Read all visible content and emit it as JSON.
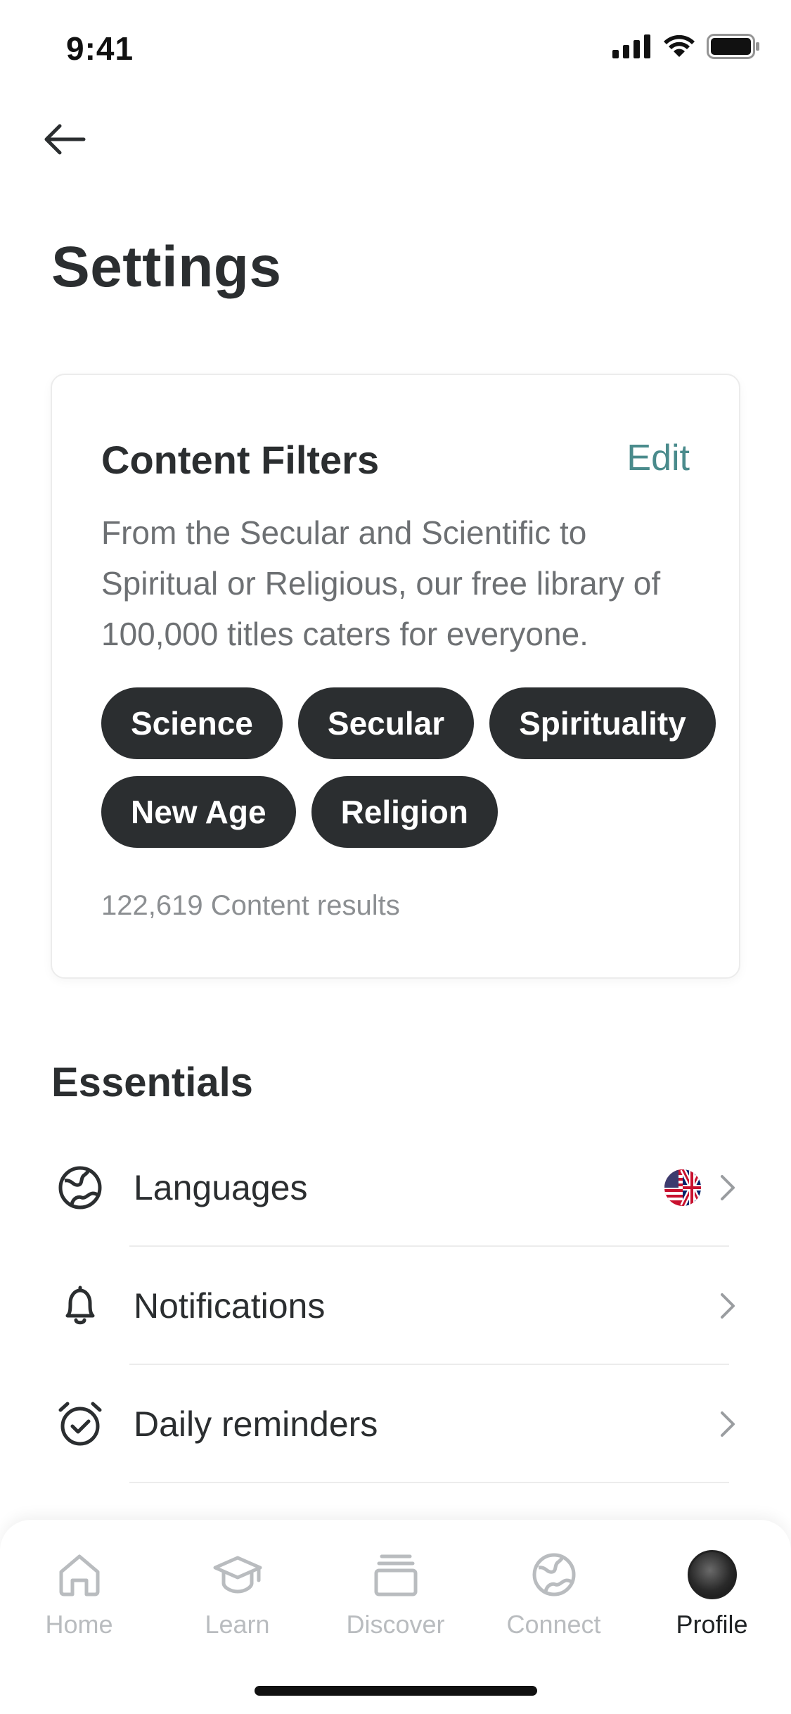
{
  "status_bar": {
    "time": "9:41"
  },
  "header": {
    "title": "Settings"
  },
  "content_filters": {
    "title": "Content Filters",
    "edit_label": "Edit",
    "description": "From the Secular and Scientific to Spiritual or Religious, our free library of 100,000 titles caters for everyone.",
    "chips": [
      "Science",
      "Secular",
      "Spirituality",
      "New Age",
      "Religion"
    ],
    "results": "122,619 Content results"
  },
  "essentials": {
    "title": "Essentials",
    "items": [
      {
        "label": "Languages",
        "icon": "globe-icon",
        "flag": "us-uk-flag"
      },
      {
        "label": "Notifications",
        "icon": "bell-icon"
      },
      {
        "label": "Daily reminders",
        "icon": "alarm-clock-icon"
      }
    ]
  },
  "tab_bar": {
    "tabs": [
      {
        "label": "Home",
        "icon": "home-icon"
      },
      {
        "label": "Learn",
        "icon": "graduation-cap-icon"
      },
      {
        "label": "Discover",
        "icon": "stack-icon"
      },
      {
        "label": "Connect",
        "icon": "globe-icon"
      },
      {
        "label": "Profile",
        "icon": "avatar"
      }
    ],
    "active": "Profile"
  },
  "colors": {
    "accent": "#4a8b8c",
    "chip_bg": "#2b2e30",
    "text": "#2b2e30",
    "muted": "#6d7073",
    "tab_inactive": "#b9bcbf"
  }
}
